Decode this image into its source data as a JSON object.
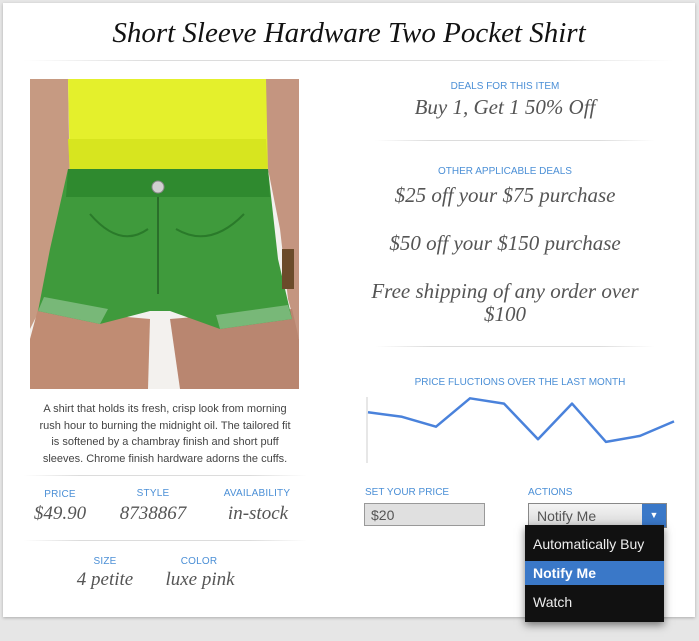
{
  "product": {
    "title": "Short Sleeve Hardware Two Pocket Shirt",
    "description": "A shirt that holds its fresh, crisp look from morning rush hour to burning the midnight oil. The tailored fit is softened by a chambray finish and short puff sleeves. Chrome finish hardware adorns the cuffs."
  },
  "specs": {
    "price_label": "PRICE",
    "price": "$49.90",
    "style_label": "STYLE",
    "style": "8738867",
    "availability_label": "AVAILABILITY",
    "availability": "in-stock",
    "size_label": "SIZE",
    "size": "4 petite",
    "color_label": "COLOR",
    "color": "luxe pink"
  },
  "deals": {
    "item_label": "DEALS FOR THIS ITEM",
    "item_deal": "Buy 1, Get 1 50% Off",
    "other_label": "OTHER APPLICABLE DEALS",
    "other": [
      "$25 off your $75 purchase",
      "$50 off your $150 purchase",
      "Free shipping of any order over $100"
    ]
  },
  "fluctuation": {
    "label": "PRICE FLUCTIONS OVER THE LAST MONTH"
  },
  "chart_data": {
    "type": "line",
    "x": [
      1,
      2,
      3,
      4,
      5,
      6,
      7,
      8,
      9,
      10
    ],
    "values": [
      0.77,
      0.7,
      0.55,
      0.98,
      0.9,
      0.36,
      0.9,
      0.32,
      0.41,
      0.63
    ],
    "ylim": [
      0,
      1
    ],
    "color": "#4a82db"
  },
  "pricing": {
    "set_label": "SET YOUR PRICE",
    "set_value": "$20",
    "actions_label": "ACTIONS",
    "selected": "Notify Me",
    "options": [
      "Automatically Buy",
      "Notify Me",
      "Watch"
    ]
  }
}
